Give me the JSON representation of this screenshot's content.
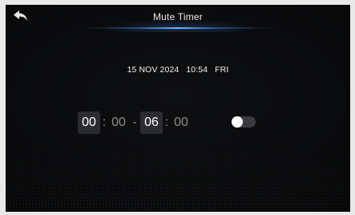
{
  "header": {
    "title": "Mute Timer",
    "back_icon": "back-arrow-icon"
  },
  "datetime": {
    "date": "15 NOV 2024",
    "time": "10:54",
    "day": "FRI"
  },
  "timer": {
    "start_hour": "00",
    "start_minute": "00",
    "end_hour": "06",
    "end_minute": "00",
    "time_separator": ":",
    "range_separator": "-"
  },
  "toggle": {
    "enabled": false
  },
  "colors": {
    "background": "#0e0f11",
    "accent_glow": "#6fb4ff",
    "digit_box": "#2b2c2f",
    "muted_text": "#8c8c8c"
  }
}
